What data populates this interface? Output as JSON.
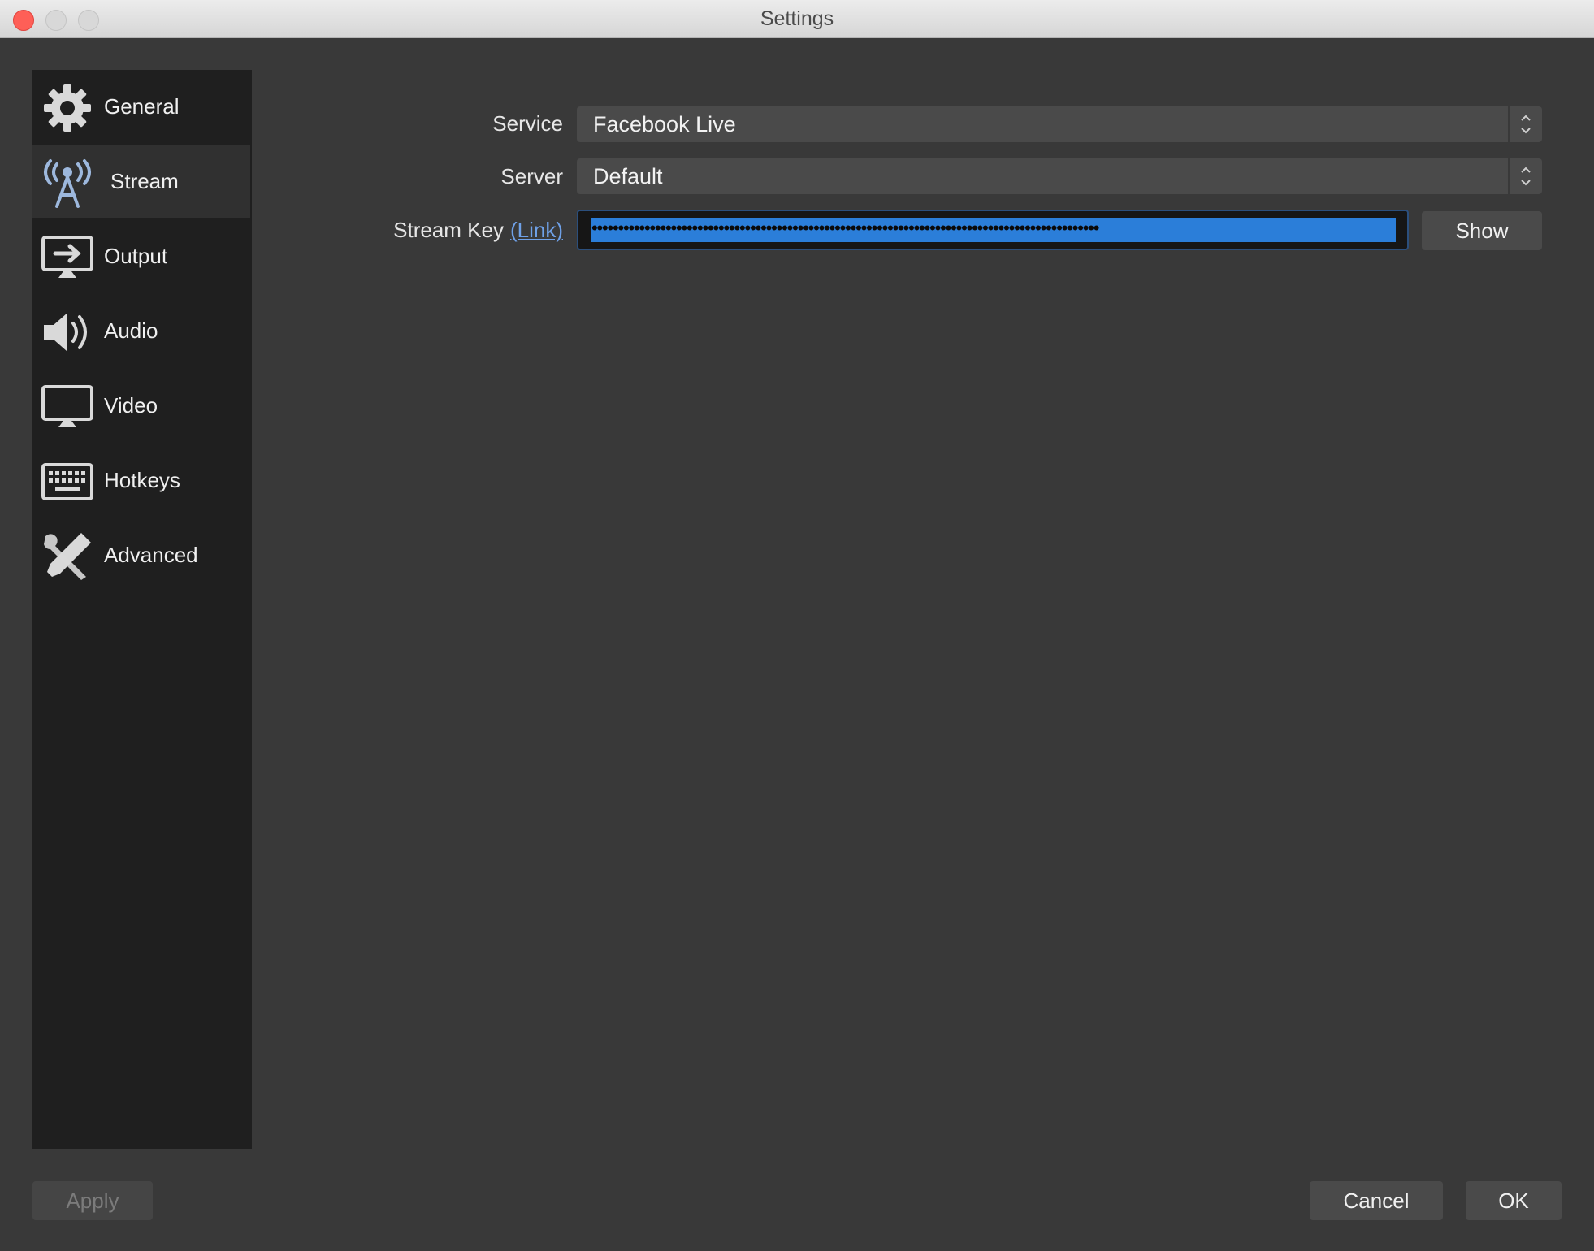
{
  "window": {
    "title": "Settings"
  },
  "sidebar": {
    "items": [
      {
        "label": "General",
        "icon": "gear-icon"
      },
      {
        "label": "Stream",
        "icon": "antenna-icon",
        "active": true
      },
      {
        "label": "Output",
        "icon": "output-icon"
      },
      {
        "label": "Audio",
        "icon": "speaker-icon"
      },
      {
        "label": "Video",
        "icon": "monitor-icon"
      },
      {
        "label": "Hotkeys",
        "icon": "keyboard-icon"
      },
      {
        "label": "Advanced",
        "icon": "tools-icon"
      }
    ]
  },
  "stream": {
    "service_label": "Service",
    "service_value": "Facebook Live",
    "server_label": "Server",
    "server_value": "Default",
    "key_label": "Stream Key",
    "key_link": "(Link)",
    "key_value": "••••••••••••••••••••••••••••••••••••••••••••••••••••••••••••••••••••••••••••••••••••••••••••••••",
    "show_label": "Show"
  },
  "footer": {
    "apply_label": "Apply",
    "cancel_label": "Cancel",
    "ok_label": "OK"
  },
  "colors": {
    "accent": "#2b7ed9",
    "link": "#6fa1e8",
    "sidebar_bg": "#1f1f1f",
    "window_bg": "#393939"
  }
}
